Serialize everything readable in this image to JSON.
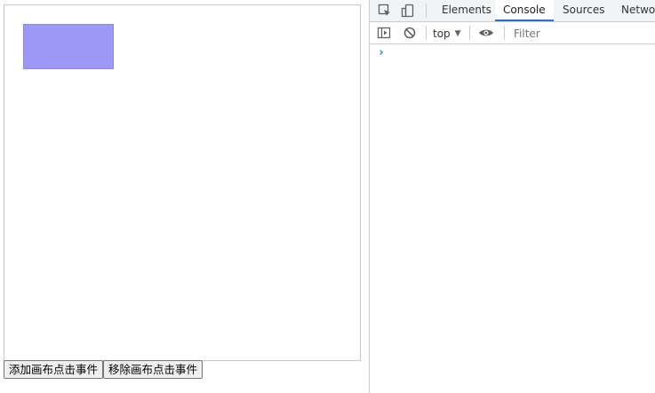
{
  "page": {
    "buttons": {
      "add_label": "添加画布点击事件",
      "remove_label": "移除画布点击事件"
    },
    "canvas_rect_color": "#9b99f3"
  },
  "devtools": {
    "tabs": [
      {
        "label": "Elements"
      },
      {
        "label": "Console"
      },
      {
        "label": "Sources"
      },
      {
        "label": "Network"
      }
    ],
    "active_tab": "Console",
    "context": "top",
    "filter_placeholder": "Filter",
    "prompt": "›",
    "accent": "#1a73e8"
  }
}
